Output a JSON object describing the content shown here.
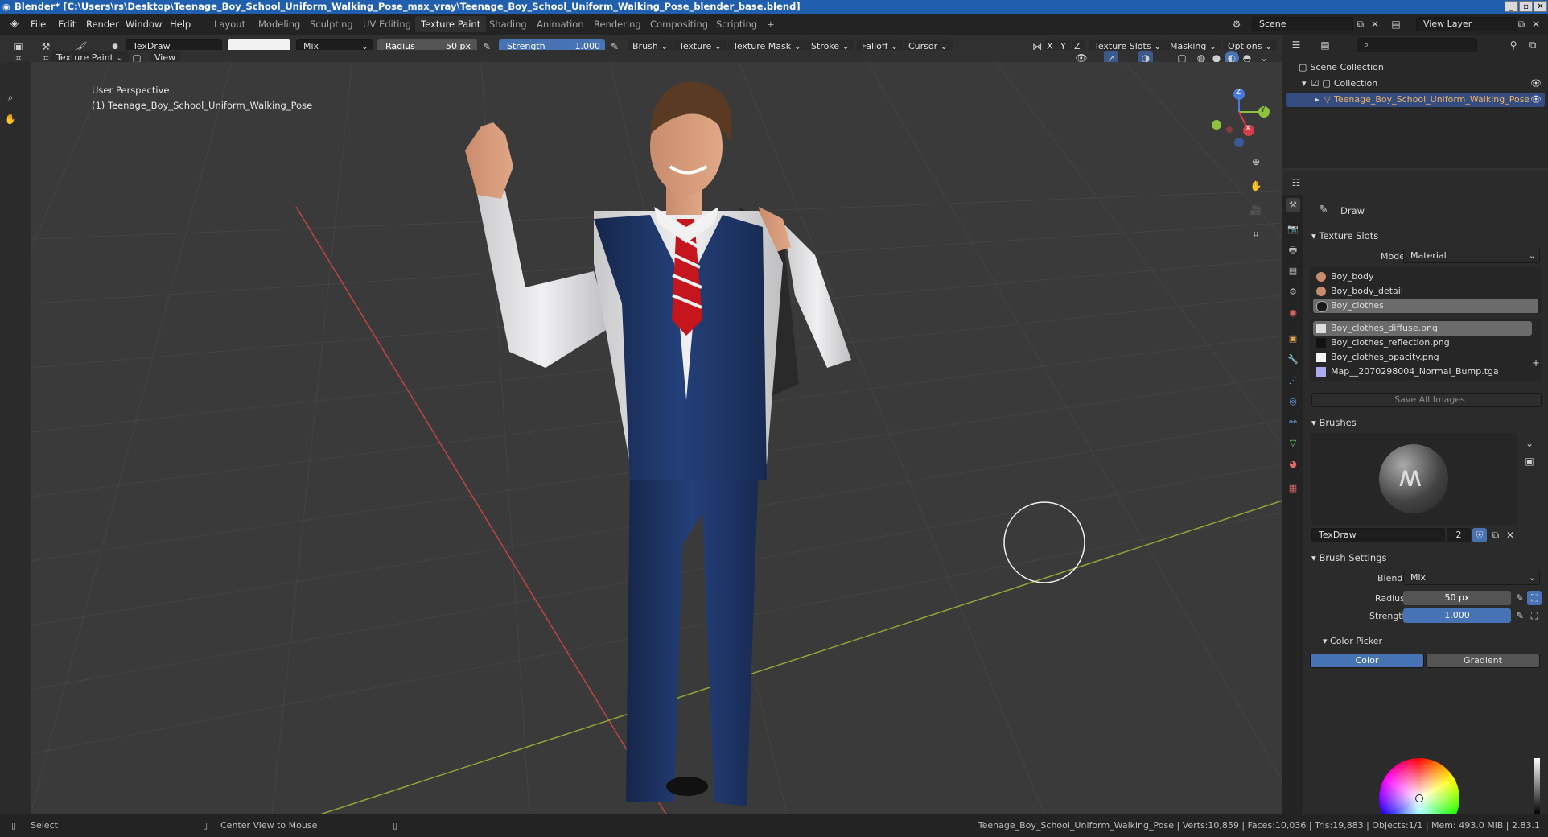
{
  "window": {
    "title": "Blender* [C:\\Users\\rs\\Desktop\\Teenage_Boy_School_Uniform_Walking_Pose_max_vray\\Teenage_Boy_School_Uniform_Walking_Pose_blender_base.blend]"
  },
  "menu": {
    "items": [
      "File",
      "Edit",
      "Render",
      "Window",
      "Help"
    ]
  },
  "workspaces": {
    "tabs": [
      "Layout",
      "Modeling",
      "Sculpting",
      "UV Editing",
      "Texture Paint",
      "Shading",
      "Animation",
      "Rendering",
      "Compositing",
      "Scripting"
    ],
    "active": "Texture Paint",
    "add": "+"
  },
  "scene": {
    "label": "Scene",
    "view_layer": "View Layer"
  },
  "toolheader": {
    "brush_name": "TexDraw",
    "blend": "Mix",
    "radius_label": "Radius",
    "radius_value": "50 px",
    "strength_label": "Strength",
    "strength_value": "1.000",
    "menus": [
      "Brush",
      "Texture",
      "Texture Mask",
      "Stroke",
      "Falloff",
      "Cursor"
    ],
    "axes": [
      "X",
      "Y",
      "Z"
    ],
    "right_menus": [
      "Texture Slots",
      "Masking",
      "Options"
    ],
    "mode": "Texture Paint",
    "view": "View"
  },
  "viewport": {
    "perspective": "User Perspective",
    "object": "(1) Teenage_Boy_School_Uniform_Walking_Pose",
    "gizmo": {
      "z": "Z",
      "y": "Y",
      "x": "X"
    }
  },
  "outliner": {
    "scene_collection": "Scene Collection",
    "collection": "Collection",
    "object": "Teenage_Boy_School_Uniform_Walking_Pose"
  },
  "properties": {
    "tool": "Draw",
    "texture_slots": {
      "title": "Texture Slots",
      "mode_label": "Mode",
      "mode_value": "Material",
      "materials": [
        "Boy_body",
        "Boy_body_detail",
        "Boy_clothes"
      ],
      "selected_material": "Boy_clothes",
      "images": [
        "Boy_clothes_diffuse.png",
        "Boy_clothes_reflection.png",
        "Boy_clothes_opacity.png",
        "Map__2070298004_Normal_Bump.tga"
      ],
      "selected_image": "Boy_clothes_diffuse.png",
      "save_all": "Save All Images"
    },
    "brushes": {
      "title": "Brushes",
      "name": "TexDraw",
      "users": "2"
    },
    "brush_settings": {
      "title": "Brush Settings",
      "blend_label": "Blend",
      "blend_value": "Mix",
      "radius_label": "Radius",
      "radius_value": "50 px",
      "strength_label": "Strength",
      "strength_value": "1.000"
    },
    "color_picker": {
      "title": "Color Picker",
      "tab_color": "Color",
      "tab_gradient": "Gradient"
    }
  },
  "statusbar": {
    "select": "Select",
    "center_view": "Center View to Mouse",
    "stats": "Teenage_Boy_School_Uniform_Walking_Pose | Verts:10,859 | Faces:10,036 | Tris:19,883 | Objects:1/1 | Mem: 493.0 MiB | 2.83.1"
  },
  "colors": {
    "accent": "#4772b3",
    "titlebar": "#1f5fae",
    "background": "#303030",
    "vest": "#1f3560",
    "shirt": "#e8e8ea",
    "tie": "#c4161c"
  }
}
